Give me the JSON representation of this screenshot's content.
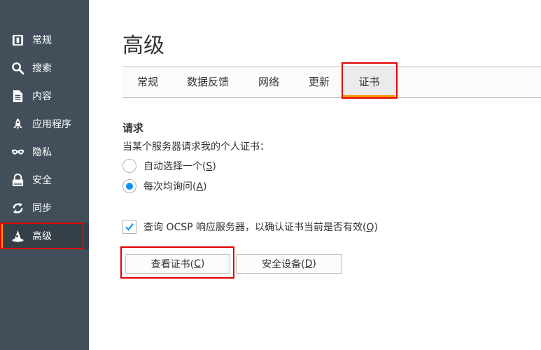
{
  "sidebar": {
    "items": [
      {
        "label": "常规",
        "icon": "general-icon"
      },
      {
        "label": "搜索",
        "icon": "search-icon"
      },
      {
        "label": "内容",
        "icon": "document-icon"
      },
      {
        "label": "应用程序",
        "icon": "rocket-icon"
      },
      {
        "label": "隐私",
        "icon": "mask-icon"
      },
      {
        "label": "安全",
        "icon": "lock-icon"
      },
      {
        "label": "同步",
        "icon": "sync-icon"
      },
      {
        "label": "高级",
        "icon": "wizard-hat-icon",
        "selected": true
      }
    ]
  },
  "page": {
    "title": "高级"
  },
  "tabs": [
    {
      "label": "常规"
    },
    {
      "label": "数据反馈"
    },
    {
      "label": "网络"
    },
    {
      "label": "更新"
    },
    {
      "label": "证书",
      "selected": true
    }
  ],
  "certificates": {
    "request_heading": "请求",
    "request_desc": "当某个服务器请求我的个人证书：",
    "radio_auto": {
      "label": "自动选择一个(",
      "key": "S",
      "suffix": ")",
      "checked": false
    },
    "radio_ask": {
      "label": "每次均询问(",
      "key": "A",
      "suffix": ")",
      "checked": true
    },
    "ocsp": {
      "label": "查询 OCSP 响应服务器，以确认证书当前是否有效(",
      "key": "Q",
      "suffix": ")",
      "checked": true
    },
    "view_button": {
      "label": "查看证书(",
      "key": "C",
      "suffix": ")"
    },
    "devices_button": {
      "label": "安全设备(",
      "key": "D",
      "suffix": ")"
    }
  },
  "colors": {
    "sidebar_bg": "#424f5a",
    "accent": "#ff9400",
    "radio_selected": "#0996f8",
    "highlight_box": "#e10000"
  }
}
